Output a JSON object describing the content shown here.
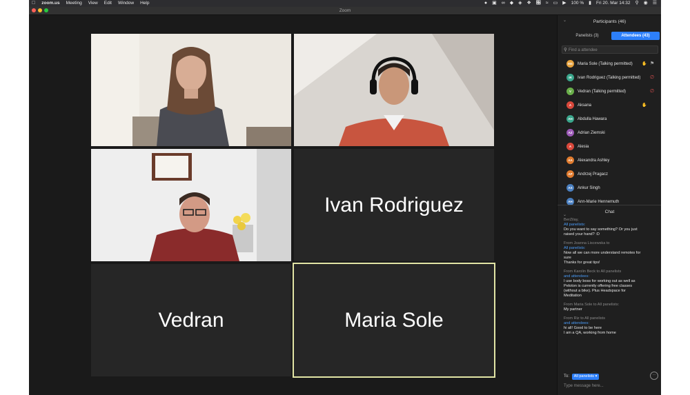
{
  "menubar": {
    "items": [
      "zoom.us",
      "Meeting",
      "View",
      "Edit",
      "Window",
      "Help"
    ],
    "battery": "100 %",
    "datetime": "Fri 20. Mar  14:32"
  },
  "window": {
    "title": "Zoom"
  },
  "stage": {
    "tiles": [
      {
        "name": "Ivan Rodriguez"
      },
      {
        "name": "Vedran"
      },
      {
        "name": "Maria Sole"
      }
    ],
    "active_speaker_color": "#e3e6a6"
  },
  "participants": {
    "header": "Participants (46)",
    "tabs": [
      {
        "label": "Panelists (3)"
      },
      {
        "label": "Attendees (43)"
      }
    ],
    "search_placeholder": "Find a attendee",
    "list": [
      {
        "initials": "MS",
        "name": "Maria Sole (Talking permitted)",
        "color": "#e7a23c",
        "hand": true,
        "mic": "on"
      },
      {
        "initials": "IR",
        "name": "Ivan Rodriguez (Talking permitted)",
        "color": "#3aa68c",
        "hand": false,
        "mic": "muted"
      },
      {
        "initials": "V",
        "name": "Vedran (Talking permitted)",
        "color": "#6aaf4a",
        "hand": false,
        "mic": "muted"
      },
      {
        "initials": "A",
        "name": "Aksana",
        "color": "#d9483b",
        "hand": true,
        "mic": ""
      },
      {
        "initials": "AH",
        "name": "Abdulla Hawara",
        "color": "#3aa68c",
        "hand": false,
        "mic": ""
      },
      {
        "initials": "AZ",
        "name": "Adrian Ziemski",
        "color": "#9b59b6",
        "hand": false,
        "mic": ""
      },
      {
        "initials": "A",
        "name": "Alesia",
        "color": "#d9483b",
        "hand": false,
        "mic": ""
      },
      {
        "initials": "AA",
        "name": "Alexandra Ashley",
        "color": "#e07b2e",
        "hand": false,
        "mic": ""
      },
      {
        "initials": "AP",
        "name": "Andrzej Pragacz",
        "color": "#e07b2e",
        "hand": false,
        "mic": ""
      },
      {
        "initials": "AS",
        "name": "Ankur Singh",
        "color": "#4a7fc0",
        "hand": false,
        "mic": ""
      },
      {
        "initials": "AH",
        "name": "Ann-Marie Hennemuth",
        "color": "#4a7fc0",
        "hand": false,
        "mic": ""
      }
    ]
  },
  "chat": {
    "header": "Chat",
    "messages": [
      {
        "from": "BerZilay,",
        "to": "All panelists:",
        "lines": [
          "Do you want to say something? Or you just",
          "raised your hand? :D"
        ]
      },
      {
        "from": "From Joanna Liscewska to",
        "to": "All panelists:",
        "lines": [
          "Now all we can more understand remotes for",
          "sure",
          "Thanks for great tips!"
        ]
      },
      {
        "from": "From Karolin Beck to All panelists",
        "to": "and attendees:",
        "lines": [
          "I use body boss for working out as well as",
          "Peloton is currently offering free classes",
          "(without a bike). Plus Headspace for",
          "Meditation"
        ]
      },
      {
        "from": "From Maria Sole to All panelists:",
        "to": "",
        "lines": [
          "My partner"
        ]
      },
      {
        "from": "From Riz to All panelists",
        "to": "and attendees:",
        "lines": [
          "hi all! Good to be here",
          "I am a QA, working from home"
        ]
      }
    ],
    "to_label": "To:",
    "to_value": "All panelists",
    "input_placeholder": "Type message here..."
  }
}
